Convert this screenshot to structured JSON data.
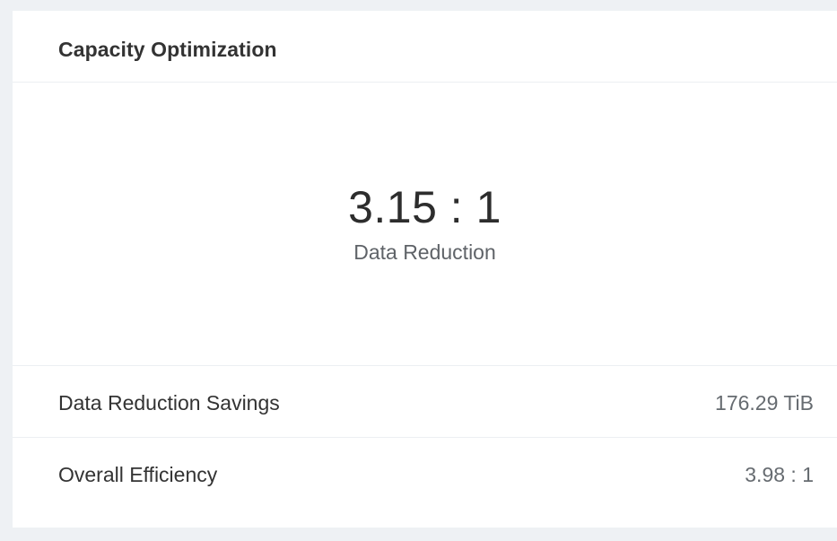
{
  "card": {
    "title": "Capacity Optimization"
  },
  "hero": {
    "value": "3.15 : 1",
    "label": "Data Reduction"
  },
  "metrics": [
    {
      "label": "Data Reduction Savings",
      "value": "176.29 TiB"
    },
    {
      "label": "Overall Efficiency",
      "value": "3.98 : 1"
    }
  ]
}
